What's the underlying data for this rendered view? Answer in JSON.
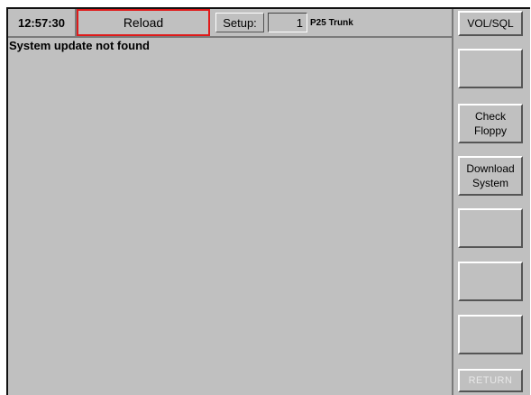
{
  "status_bar": {
    "time": "12:57:30",
    "reload_label": "Reload",
    "setup_label": "Setup:",
    "setup_number": "1",
    "system_name": "P25 Trunk"
  },
  "message": "System update not found",
  "side_buttons": [
    {
      "label": "VOL/SQL",
      "enabled": true
    },
    {
      "label": "",
      "enabled": true
    },
    {
      "label": "Check\nFloppy",
      "enabled": true
    },
    {
      "label": "Download\nSystem",
      "enabled": true
    },
    {
      "label": "",
      "enabled": true
    },
    {
      "label": "",
      "enabled": true
    },
    {
      "label": "",
      "enabled": true
    },
    {
      "label": "RETURN",
      "enabled": false
    }
  ],
  "colors": {
    "panel": "#c0c0c0",
    "highlight_border": "#e01a1a"
  }
}
